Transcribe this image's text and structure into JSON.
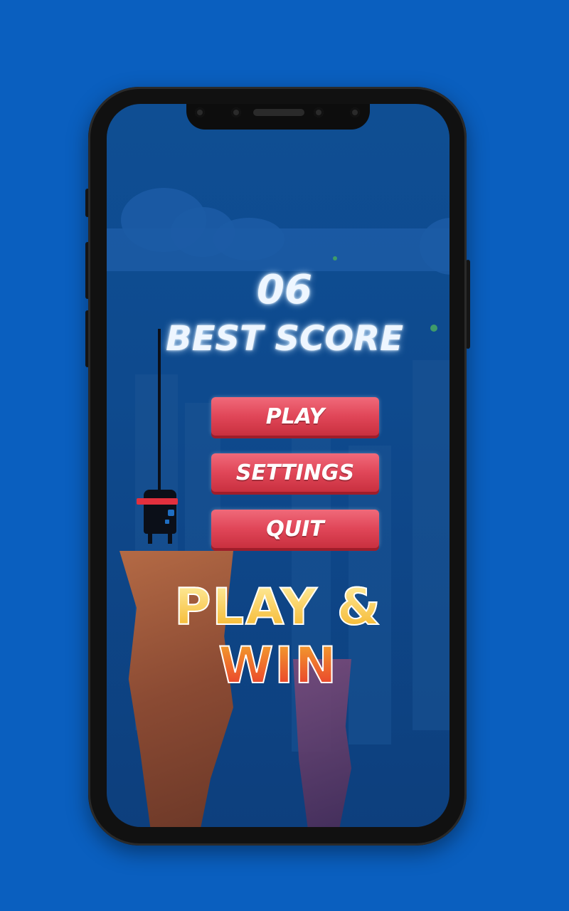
{
  "score": {
    "value": "06",
    "label": "BEST SCORE"
  },
  "menu": {
    "play": "PLAY",
    "settings": "SETTINGS",
    "quit": "QUIT"
  },
  "tagline": "PLAY & WIN",
  "colors": {
    "background": "#0a5fbf",
    "button": "#e04658",
    "tagline_top": "#fff1a8",
    "tagline_bottom": "#e8312c"
  },
  "icons": {
    "character": "ninja-character-icon",
    "pole": "stick-icon"
  }
}
